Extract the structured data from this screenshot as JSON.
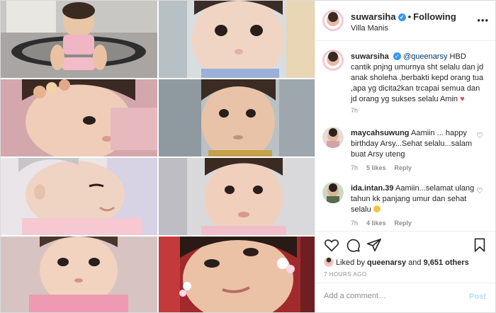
{
  "header": {
    "username": "suwarsiha",
    "verified_icon": "verified-badge-icon",
    "separator": "•",
    "follow_label": "Following",
    "location": "Villa Manis",
    "more": "•••"
  },
  "caption": {
    "username": "suwarsiha",
    "mention": "@queenarsy",
    "text": "HBD cantik pnjng umurnya sht selalu dan jd anak sholeha ,berbakti kepd orang tua ,apa yg dicita2kan trcapai semua dan jd orang yg sukses selalu Amin",
    "emoji": "♥",
    "time": "7h"
  },
  "comments": [
    {
      "username": "maycahsuwung",
      "text": "Aamiin ... happy birthday Arsy...Sehat selalu...salam buat Arsy uteng",
      "time": "7h",
      "likes": "5 likes",
      "reply": "Reply"
    },
    {
      "username": "ida.intan.39",
      "text": "Aamiin...selamat ulang tahun kk panjang umur dan sehat selalu",
      "time": "7h",
      "likes": "4 likes",
      "reply": "Reply"
    }
  ],
  "actions": {
    "icons": [
      "heart-icon",
      "comment-icon",
      "share-icon",
      "bookmark-icon"
    ],
    "liked_by_prefix": "Liked by",
    "liked_by_user": "queenarsy",
    "liked_by_joiner": "and",
    "liked_by_count": "9,651 others",
    "timestamp": "7 HOURS AGO"
  },
  "add_comment": {
    "placeholder": "Add a comment…",
    "post_label": "Post"
  },
  "colors": {
    "accent": "#3897f0",
    "post_button_disabled": "#b2dffc",
    "mention": "#00376b",
    "heart": "#ed4956"
  }
}
